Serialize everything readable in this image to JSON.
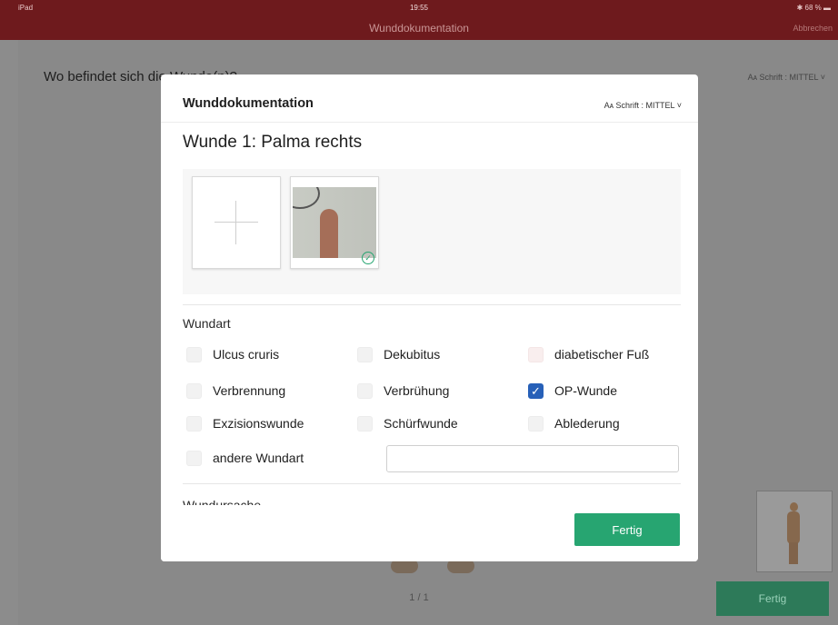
{
  "status_bar": {
    "device": "iPad",
    "time": "19:55",
    "battery": "68 %"
  },
  "nav": {
    "title": "Wunddokumentation",
    "cancel_label": "Abbrechen"
  },
  "background": {
    "question": "Wo befindet sich die Wunde(n)?",
    "font_label": "Schrift : MITTEL",
    "page_indicator": "1 / 1",
    "done_label": "Fertig"
  },
  "modal": {
    "title": "Wunddokumentation",
    "font_prefix": "A",
    "font_label": "Schrift : MITTEL",
    "wound_title": "Wunde 1: Palma rechts",
    "photo_count": 1,
    "wound_type": {
      "label": "Wundart",
      "options": [
        {
          "label": "Ulcus cruris",
          "checked": false
        },
        {
          "label": "Dekubitus",
          "checked": false
        },
        {
          "label": "diabetischer Fuß",
          "checked": false
        },
        {
          "label": "Verbrennung",
          "checked": false
        },
        {
          "label": "Verbrühung",
          "checked": false
        },
        {
          "label": "OP-Wunde",
          "checked": true
        },
        {
          "label": "Exzisionswunde",
          "checked": false
        },
        {
          "label": "Schürfwunde",
          "checked": false
        },
        {
          "label": "Ablederung",
          "checked": false
        },
        {
          "label": "andere Wundart",
          "checked": false
        }
      ],
      "other_value": ""
    },
    "next_section_label": "Wundursache",
    "done_label": "Fertig"
  },
  "colors": {
    "nav_bar": "#6e1a1d",
    "accent_green": "#27a571",
    "checkbox_blue": "#2760b8"
  }
}
